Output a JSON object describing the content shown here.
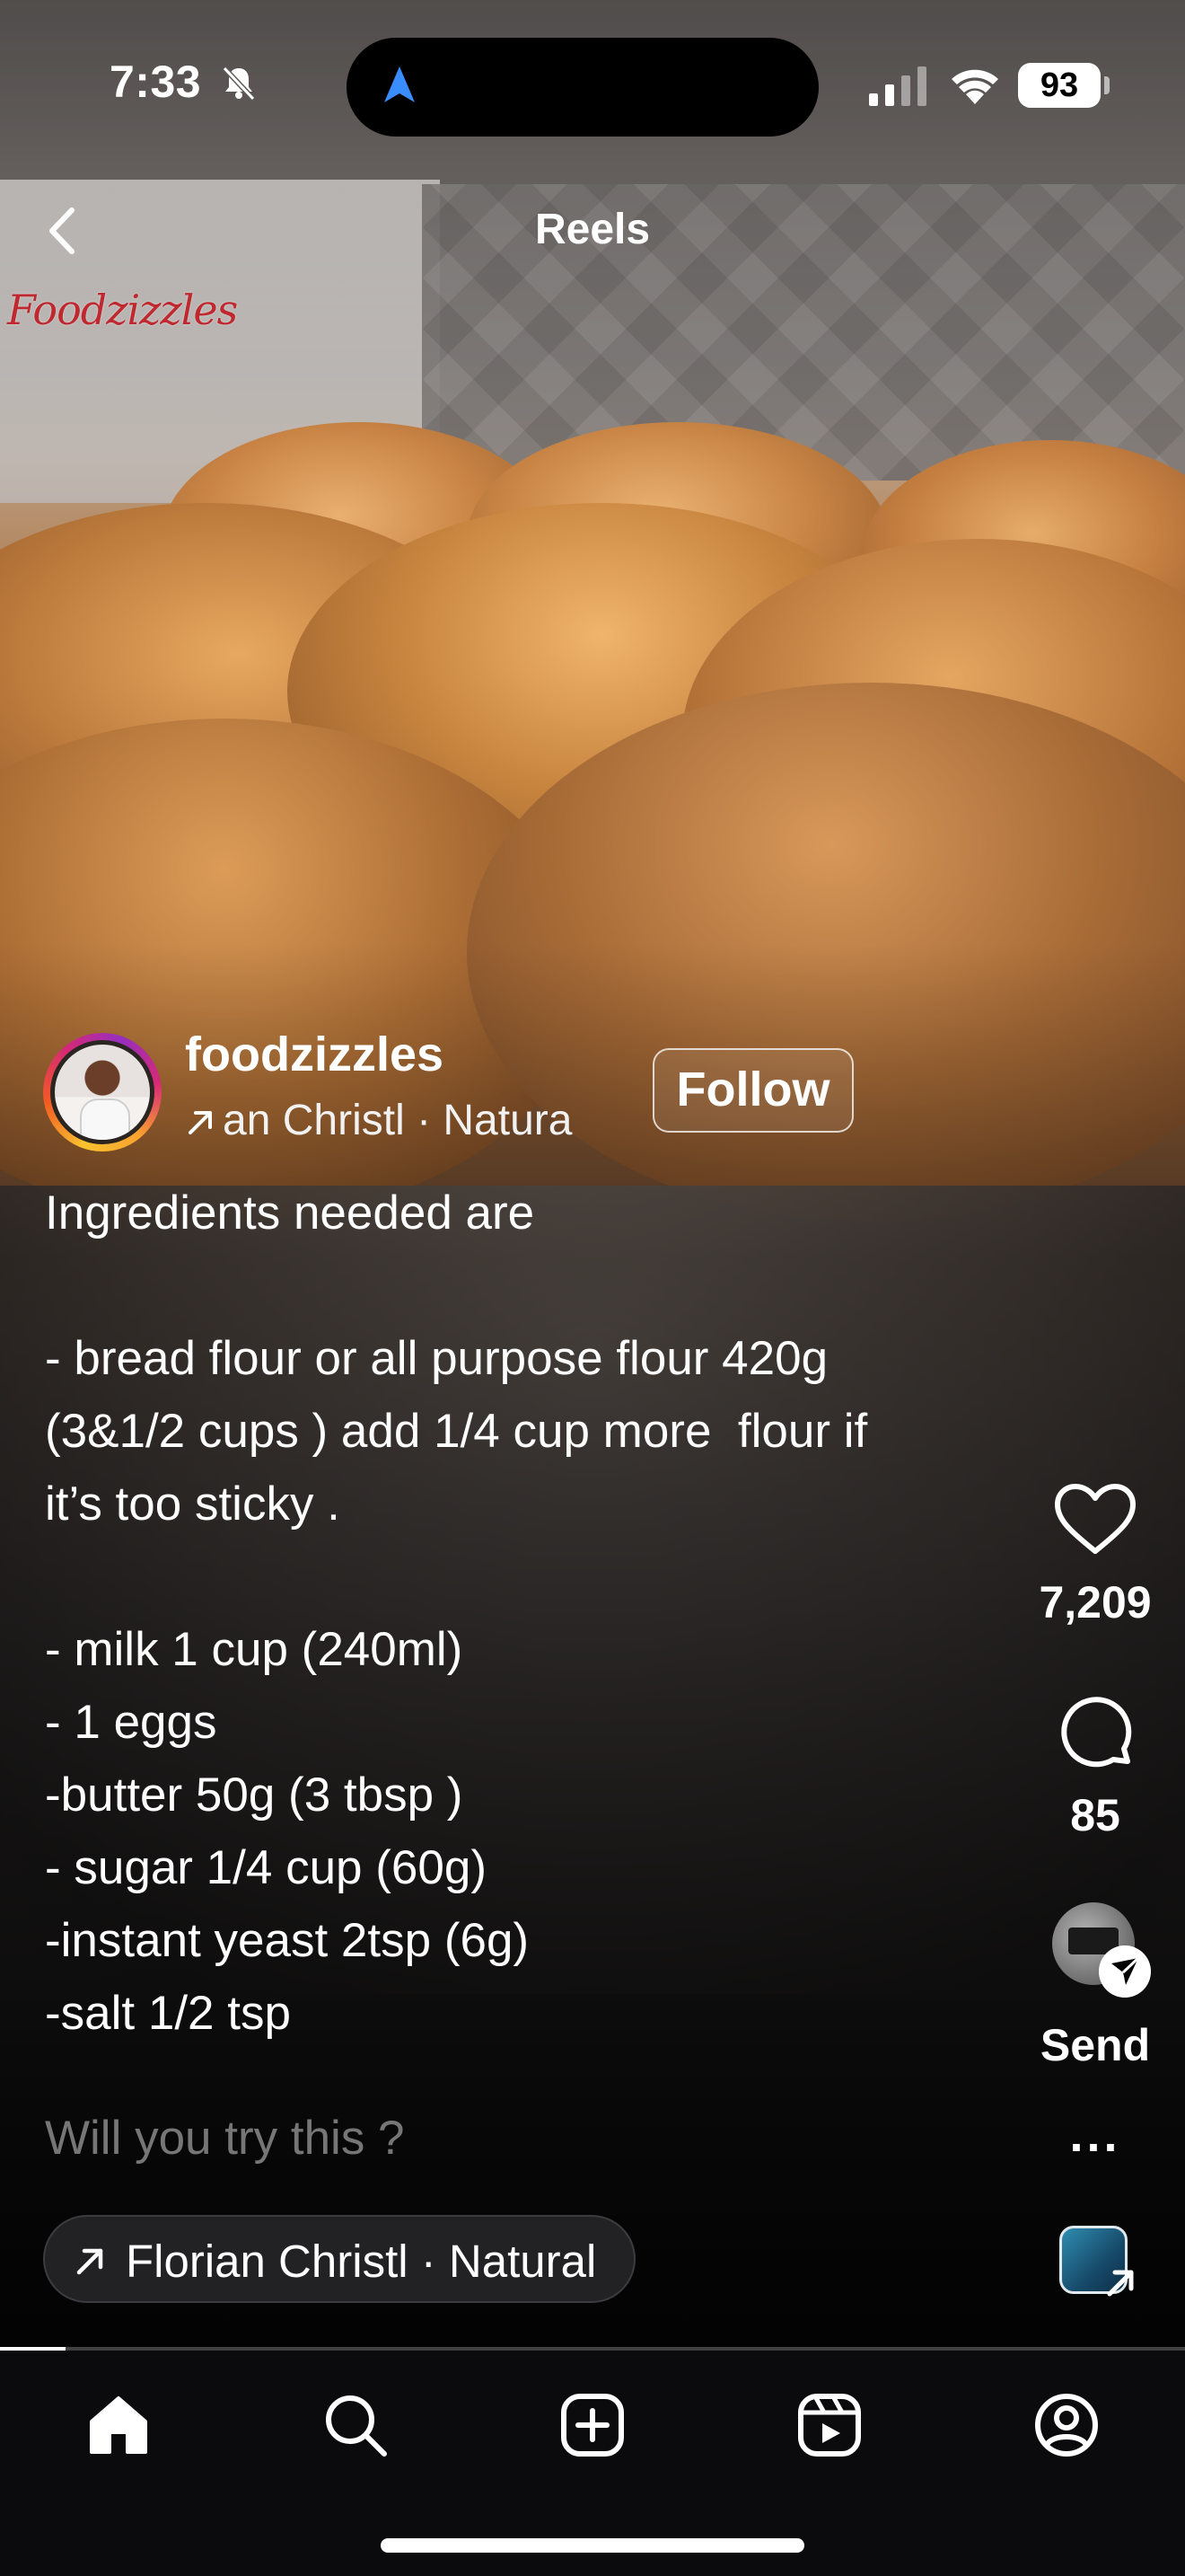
{
  "status_bar": {
    "time": "7:33",
    "battery": "93"
  },
  "header": {
    "title": "Reels"
  },
  "video": {
    "watermark_text": "Foodzizzles"
  },
  "creator": {
    "username": "foodzizzles",
    "audio_preview": "an Christl · Natura",
    "follow_label": "Follow"
  },
  "caption": {
    "lines": [
      "Ingredients needed are",
      "",
      "- bread flour or all purpose flour 420g",
      "(3&1/2 cups ) add 1/4 cup more  flour if",
      "it’s too sticky .",
      "",
      "- milk 1 cup (240ml)",
      "- 1 eggs",
      "-butter 50g (3 tbsp )",
      "- sugar 1/4 cup (60g)",
      "-instant yeast 2tsp (6g)",
      "-salt 1/2 tsp"
    ],
    "more_line": "Will you try this ?"
  },
  "actions": {
    "like_count": "7,209",
    "comment_count": "85",
    "send_label": "Send",
    "more_label": "..."
  },
  "audio": {
    "track": "Florian Christl · Natural"
  },
  "progress": {
    "fraction": 0.055
  },
  "bottom_nav": {
    "items": [
      {
        "icon": "home-icon"
      },
      {
        "icon": "search-icon"
      },
      {
        "icon": "create-icon"
      },
      {
        "icon": "reels-icon"
      },
      {
        "icon": "profile-icon"
      }
    ]
  },
  "colors": {
    "accent_blue": "#3a8dff",
    "text": "#ffffff",
    "nav_bg": "#0b0b0d"
  }
}
